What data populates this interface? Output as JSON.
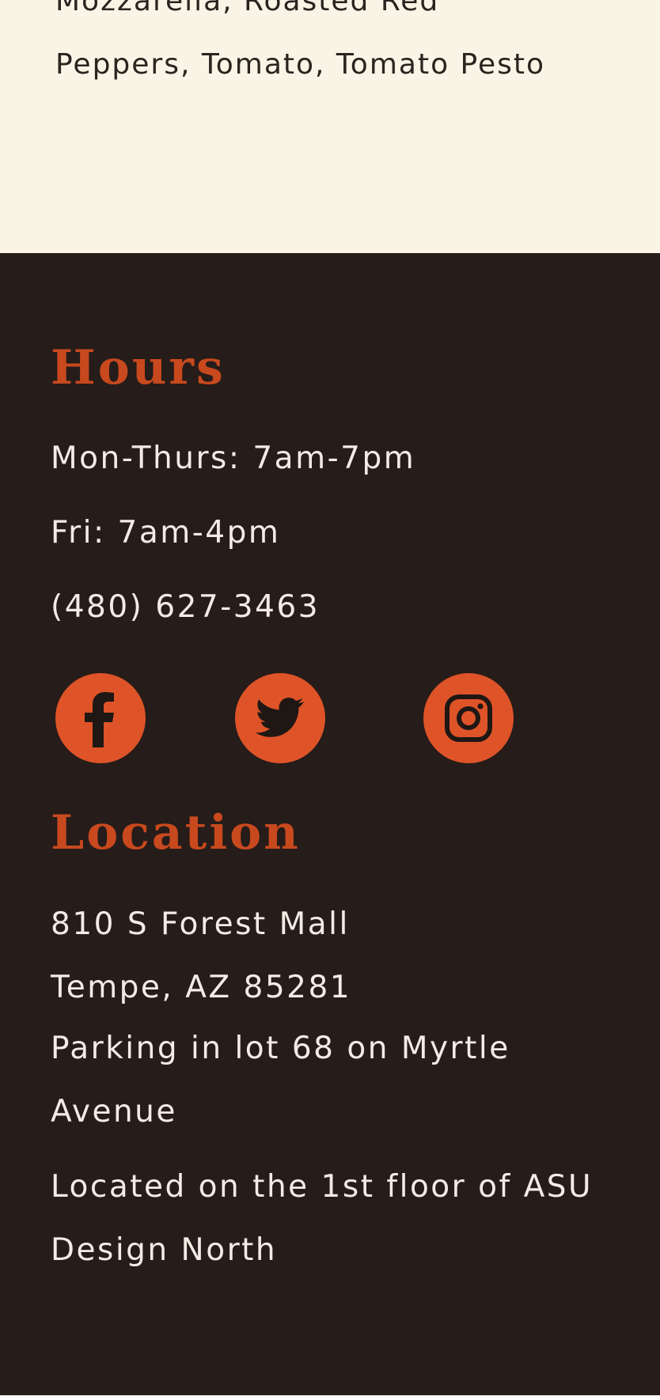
{
  "menu_item": {
    "description": "Mozzarella, Roasted Red Peppers, Tomato, Tomato Pesto"
  },
  "hours": {
    "heading": "Hours",
    "weekdays": "Mon-Thurs: 7am-7pm",
    "friday": "Fri: 7am-4pm",
    "phone": "(480) 627-3463"
  },
  "social": {
    "accent_color": "#de5428",
    "icons": [
      "facebook-icon",
      "twitter-icon",
      "instagram-icon"
    ]
  },
  "location": {
    "heading": "Location",
    "street": "810 S Forest Mall",
    "city": "Tempe, AZ 85281",
    "parking": "Parking in lot 68 on Myrtle Avenue",
    "floor": "Located on the 1st floor of ASU Design North"
  },
  "colors": {
    "cream_background": "#faf4e6",
    "footer_background": "#261c19",
    "heading_orange": "#c8491e",
    "footer_text": "#f2ece4"
  }
}
